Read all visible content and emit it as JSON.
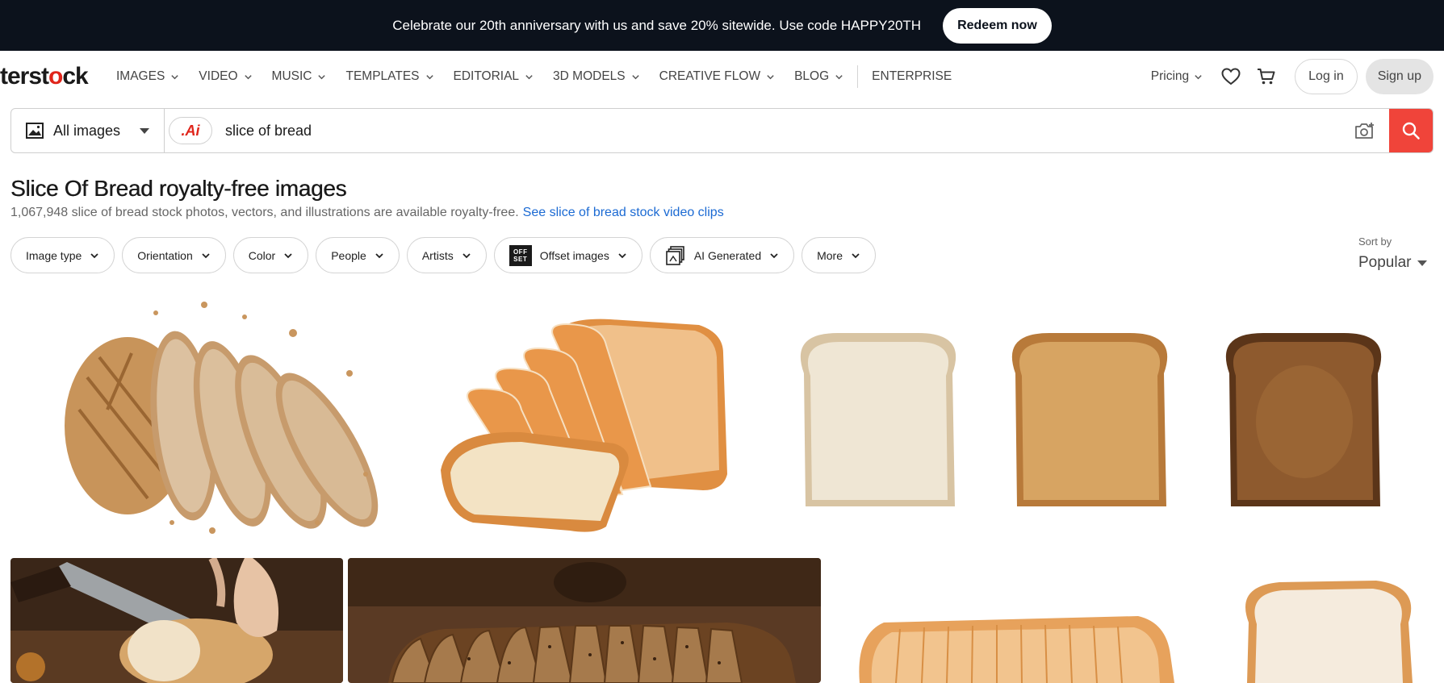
{
  "promo": {
    "text": "Celebrate our 20th anniversary with us and save 20% sitewide. Use code HAPPY20TH",
    "button": "Redeem now"
  },
  "brand": {
    "logo_prefix": "terst",
    "logo_red": "o",
    "logo_suffix": "ck"
  },
  "nav": {
    "items": [
      "IMAGES",
      "VIDEO",
      "MUSIC",
      "TEMPLATES",
      "EDITORIAL",
      "3D MODELS",
      "CREATIVE FLOW",
      "BLOG"
    ],
    "enterprise": "ENTERPRISE",
    "pricing": "Pricing",
    "login": "Log in",
    "signup": "Sign up"
  },
  "search": {
    "scope": "All images",
    "ai_badge": ".Ai",
    "query": "slice of bread"
  },
  "page": {
    "title": "Slice Of Bread royalty-free images",
    "subtitle": "1,067,948 slice of bread stock photos, vectors, and illustrations are available royalty-free.",
    "video_link": "See slice of bread stock video clips"
  },
  "filters": [
    "Image type",
    "Orientation",
    "Color",
    "People",
    "Artists",
    "Offset images",
    "AI Generated",
    "More"
  ],
  "offset_logo": [
    "OFF",
    "SET"
  ],
  "sort": {
    "label": "Sort by",
    "value": "Popular"
  },
  "results": [
    {
      "name": "sourdough-loaf-slices"
    },
    {
      "name": "sliced-white-bread-loaf"
    },
    {
      "name": "three-toast-slices"
    },
    {
      "name": "hand-cutting-bread"
    },
    {
      "name": "sliced-seeded-loaf"
    },
    {
      "name": "white-bread-loaf-side"
    },
    {
      "name": "white-bread-slice"
    }
  ],
  "colors": {
    "accent": "#f0443a",
    "banner": "#0c121c",
    "link": "#1b6ad3"
  }
}
